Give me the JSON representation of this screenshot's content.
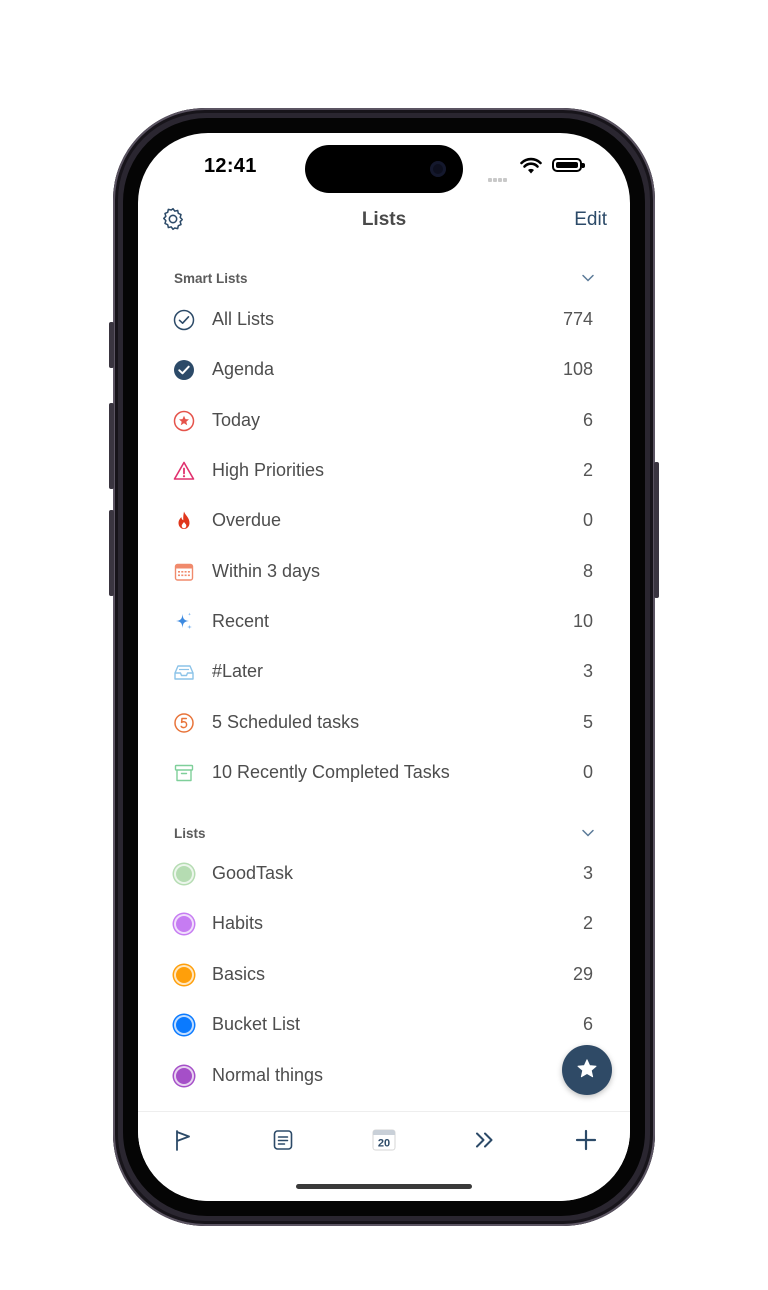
{
  "status_bar": {
    "time": "12:41"
  },
  "nav": {
    "title": "Lists",
    "edit_label": "Edit"
  },
  "smart_lists": {
    "header": "Smart Lists",
    "items": [
      {
        "label": "All Lists",
        "count": "774",
        "icon": "check-circle-outline-icon"
      },
      {
        "label": "Agenda",
        "count": "108",
        "icon": "check-circle-filled-icon"
      },
      {
        "label": "Today",
        "count": "6",
        "icon": "star-circle-icon"
      },
      {
        "label": "High Priorities",
        "count": "2",
        "icon": "warning-triangle-icon"
      },
      {
        "label": "Overdue",
        "count": "0",
        "icon": "flame-icon"
      },
      {
        "label": "Within 3 days",
        "count": "8",
        "icon": "calendar-icon"
      },
      {
        "label": "Recent",
        "count": "10",
        "icon": "sparkles-icon"
      },
      {
        "label": "#Later",
        "count": "3",
        "icon": "inbox-tray-icon"
      },
      {
        "label": "5 Scheduled tasks",
        "count": "5",
        "icon": "number-five-circle-icon"
      },
      {
        "label": "10 Recently Completed Tasks",
        "count": "0",
        "icon": "archive-box-icon"
      }
    ]
  },
  "lists": {
    "header": "Lists",
    "items": [
      {
        "label": "GoodTask",
        "count": "3",
        "color": "#b5dcb2"
      },
      {
        "label": "Habits",
        "count": "2",
        "color": "#c67cf2"
      },
      {
        "label": "Basics",
        "count": "29",
        "color": "#ff9f0a"
      },
      {
        "label": "Bucket List",
        "count": "6",
        "color": "#0a7aff"
      },
      {
        "label": "Normal things",
        "count": "",
        "color": "#a54fc8"
      }
    ]
  },
  "fab": {
    "icon": "star-icon"
  },
  "tab_bar": {
    "items": [
      {
        "icon": "flag-icon"
      },
      {
        "icon": "list-icon"
      },
      {
        "icon": "calendar-day-icon",
        "day": "20"
      },
      {
        "icon": "double-chevron-right-icon"
      },
      {
        "icon": "plus-icon"
      }
    ]
  },
  "colors": {
    "accent": "#2c4a68",
    "text": "#4d4d4d"
  }
}
